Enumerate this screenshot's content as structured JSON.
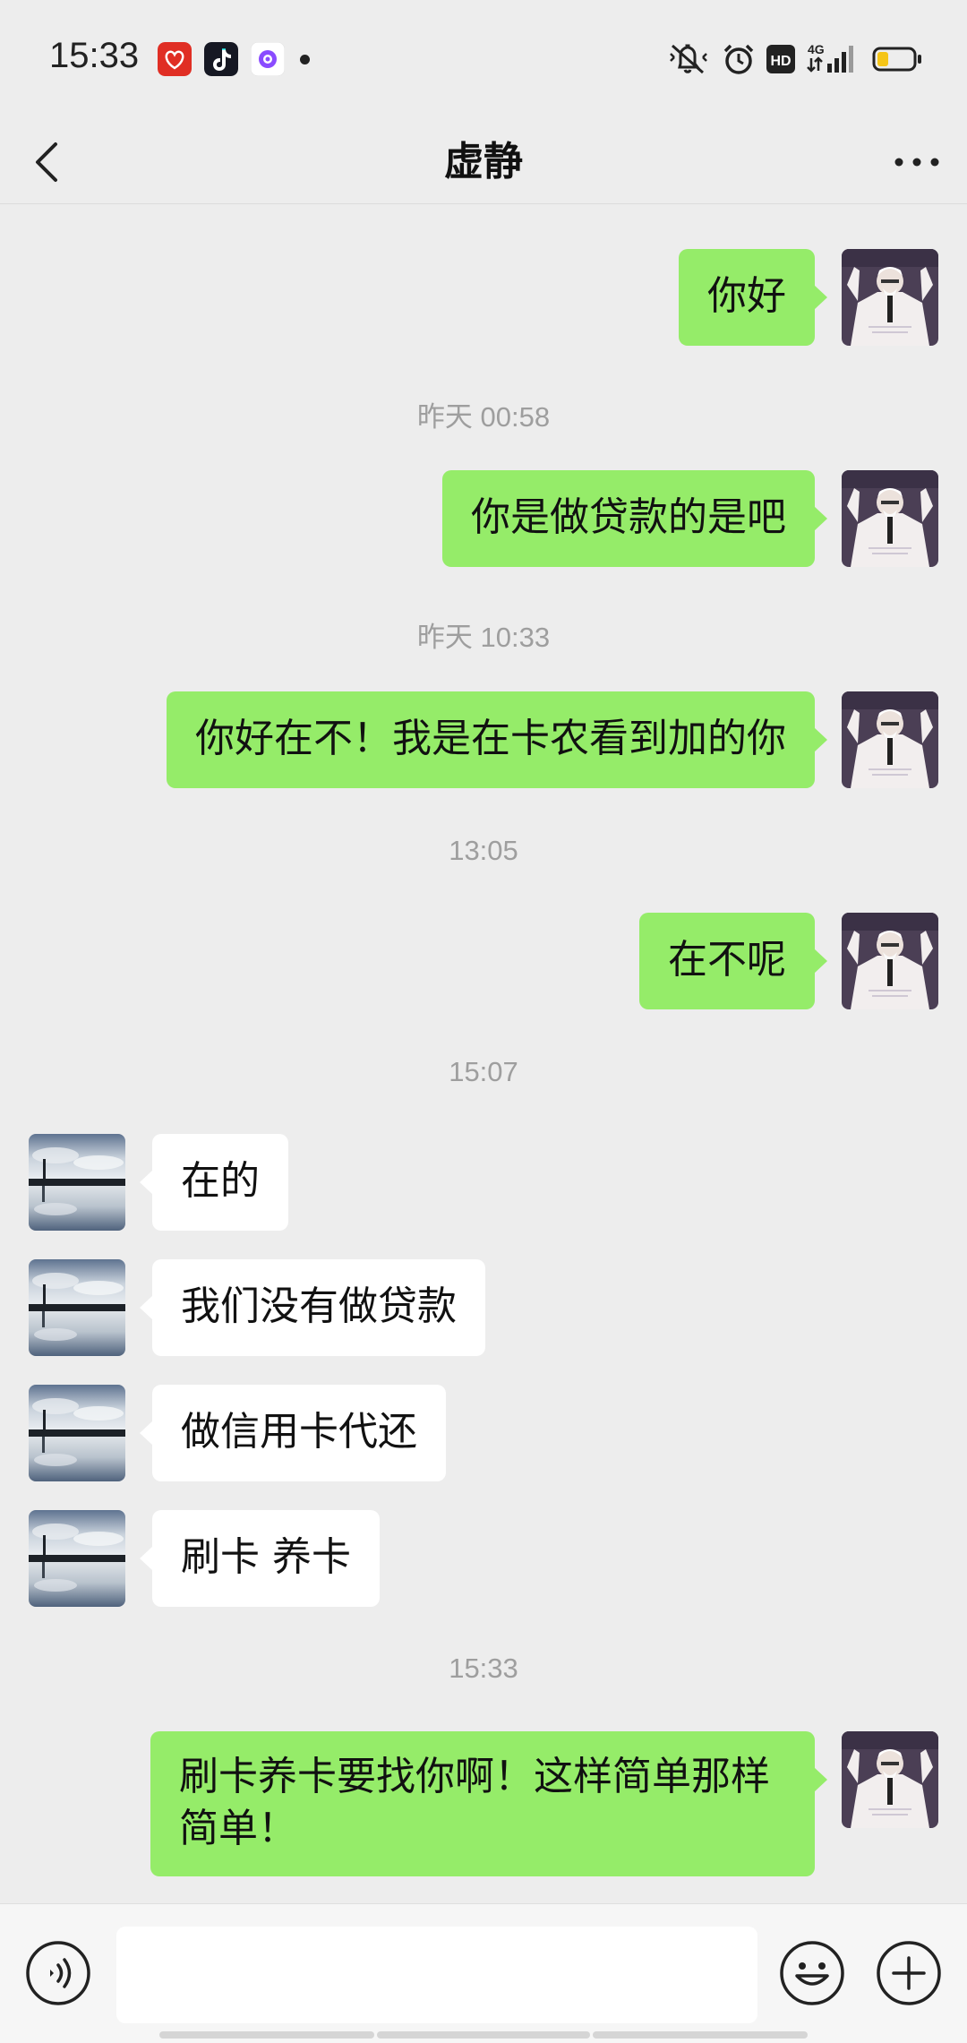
{
  "status_bar": {
    "time": "15:33",
    "app_icons": [
      "pinduoduo-icon",
      "tiktok-icon",
      "camera-app-icon"
    ],
    "indicators": [
      "mute-icon",
      "alarm-icon",
      "hd-icon",
      "4g-signal-icon",
      "battery-icon"
    ],
    "network": "4G",
    "hd": "HD"
  },
  "header": {
    "title": "虚静",
    "back_icon": "chevron-left-icon",
    "more_icon": "more-icon"
  },
  "messages": [
    {
      "text": "你好"
    },
    {
      "timestamp": "昨天 00:58"
    },
    {
      "text": "你是做贷款的是吧"
    },
    {
      "timestamp": "昨天 10:33"
    },
    {
      "text": "你好在不！我是在卡农看到加的你"
    },
    {
      "timestamp": "13:05"
    },
    {
      "text": "在不呢"
    },
    {
      "timestamp": "15:07"
    },
    {
      "text": "在的"
    },
    {
      "text": "我们没有做贷款"
    },
    {
      "text": "做信用卡代还"
    },
    {
      "text": "刷卡 养卡"
    },
    {
      "timestamp": "15:33"
    },
    {
      "text_line1": "刷卡养卡要找你啊！这样简单那样",
      "text_line2": "简单！"
    }
  ],
  "input_bar": {
    "voice_icon": "voice-icon",
    "emoji_icon": "emoji-icon",
    "plus_icon": "plus-icon",
    "value": ""
  },
  "colors": {
    "background": "#ededed",
    "outgoing_bubble": "#95ec69",
    "incoming_bubble": "#ffffff",
    "timestamp": "#9e9e9e"
  }
}
